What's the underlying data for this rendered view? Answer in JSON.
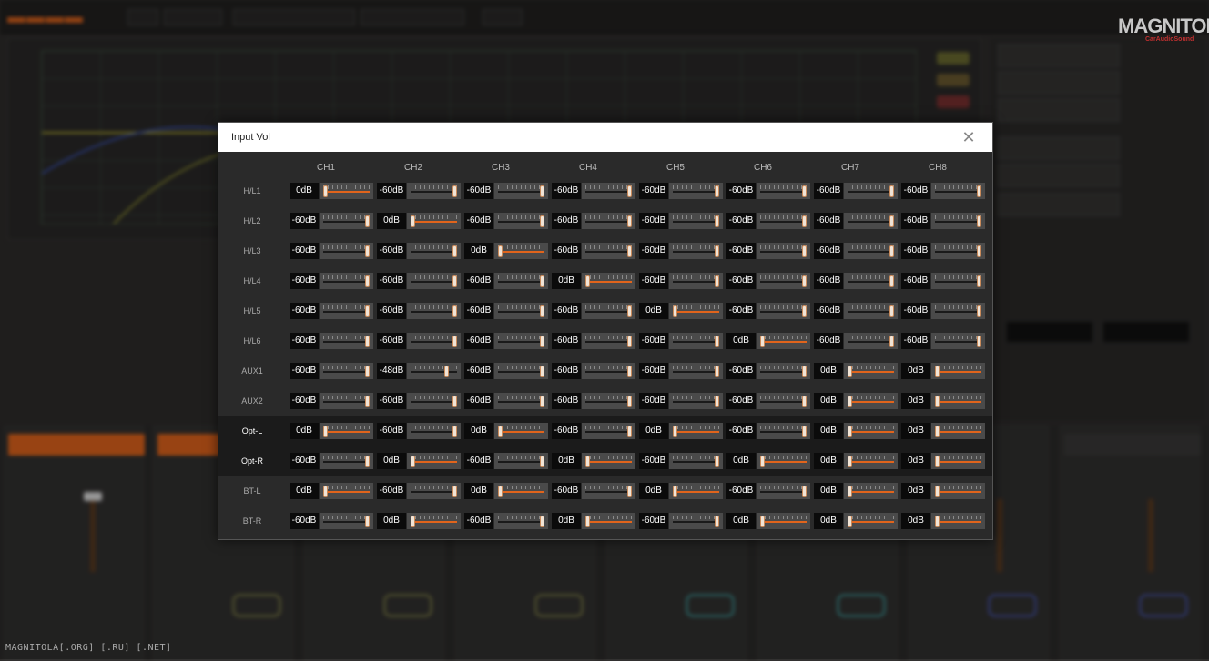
{
  "modal": {
    "title": "Input Vol",
    "close_icon": "close-icon"
  },
  "channels": [
    "CH1",
    "CH2",
    "CH3",
    "CH4",
    "CH5",
    "CH6",
    "CH7",
    "CH8"
  ],
  "rows": [
    {
      "label": "H/L1",
      "values": [
        "0dB",
        "-60dB",
        "-60dB",
        "-60dB",
        "-60dB",
        "-60dB",
        "-60dB",
        "-60dB"
      ],
      "highlight": false
    },
    {
      "label": "H/L2",
      "values": [
        "-60dB",
        "0dB",
        "-60dB",
        "-60dB",
        "-60dB",
        "-60dB",
        "-60dB",
        "-60dB"
      ],
      "highlight": false
    },
    {
      "label": "H/L3",
      "values": [
        "-60dB",
        "-60dB",
        "0dB",
        "-60dB",
        "-60dB",
        "-60dB",
        "-60dB",
        "-60dB"
      ],
      "highlight": false
    },
    {
      "label": "H/L4",
      "values": [
        "-60dB",
        "-60dB",
        "-60dB",
        "0dB",
        "-60dB",
        "-60dB",
        "-60dB",
        "-60dB"
      ],
      "highlight": false
    },
    {
      "label": "H/L5",
      "values": [
        "-60dB",
        "-60dB",
        "-60dB",
        "-60dB",
        "0dB",
        "-60dB",
        "-60dB",
        "-60dB"
      ],
      "highlight": false
    },
    {
      "label": "H/L6",
      "values": [
        "-60dB",
        "-60dB",
        "-60dB",
        "-60dB",
        "-60dB",
        "0dB",
        "-60dB",
        "-60dB"
      ],
      "highlight": false
    },
    {
      "label": "AUX1",
      "values": [
        "-60dB",
        "-48dB",
        "-60dB",
        "-60dB",
        "-60dB",
        "-60dB",
        "0dB",
        "0dB"
      ],
      "highlight": false
    },
    {
      "label": "AUX2",
      "values": [
        "-60dB",
        "-60dB",
        "-60dB",
        "-60dB",
        "-60dB",
        "-60dB",
        "0dB",
        "0dB"
      ],
      "highlight": false
    },
    {
      "label": "Opt-L",
      "values": [
        "0dB",
        "-60dB",
        "0dB",
        "-60dB",
        "0dB",
        "-60dB",
        "0dB",
        "0dB"
      ],
      "highlight": true
    },
    {
      "label": "Opt-R",
      "values": [
        "-60dB",
        "0dB",
        "-60dB",
        "0dB",
        "-60dB",
        "0dB",
        "0dB",
        "0dB"
      ],
      "highlight": true
    },
    {
      "label": "BT-L",
      "values": [
        "0dB",
        "-60dB",
        "0dB",
        "-60dB",
        "0dB",
        "-60dB",
        "0dB",
        "0dB"
      ],
      "highlight": false
    },
    {
      "label": "BT-R",
      "values": [
        "-60dB",
        "0dB",
        "-60dB",
        "0dB",
        "-60dB",
        "0dB",
        "0dB",
        "0dB"
      ],
      "highlight": false
    }
  ],
  "slider_range_db": [
    0,
    -60
  ],
  "colors": {
    "accent": "#e0641c",
    "modal_bg": "#2a2a2a",
    "header_bg": "#ffffff"
  },
  "brand": {
    "name": "MAGNITOLA",
    "sub": "CarAudioSound"
  },
  "watermark": "MAGNITOLA[.ORG] [.RU] [.NET]"
}
